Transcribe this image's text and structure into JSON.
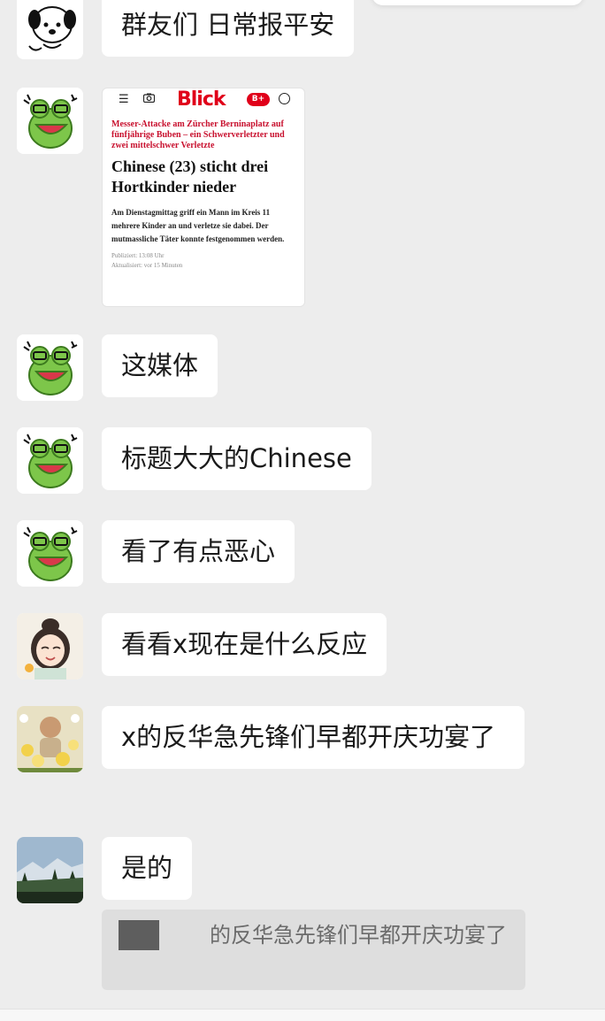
{
  "messages": [
    {
      "text": "群友们 日常报平安"
    },
    {
      "article": {
        "brand": "Blick",
        "plus_badge": "B+",
        "kicker": "Messer-Attacke am Zürcher Berninaplatz auf fünfjährige Buben – ein Schwerverletzter und zwei mittelschwer Verletzte",
        "headline": "Chinese (23) sticht drei Hortkinder nieder",
        "lead": "Am Dienstagmittag griff ein Mann im Kreis 11 mehrere Kinder an und verletze sie dabei. Der mutmassliche Täter konnte festgenommen werden.",
        "published": "Publiziert: 13:08 Uhr",
        "updated": "Aktualisiert: vor 15 Minuten"
      }
    },
    {
      "text": "这媒体"
    },
    {
      "text": "标题大大的Chinese"
    },
    {
      "text": "看了有点恶心"
    },
    {
      "text": "看看x现在是什么反应"
    },
    {
      "text": "x的反华急先锋们早都开庆功宴了"
    },
    {
      "text": "是的"
    }
  ],
  "quoted_reply": {
    "text": "的反华急先锋们早都开庆功宴了"
  },
  "icons": {
    "menu": "hamburger-icon",
    "camera": "camera-icon",
    "account": "user-icon"
  },
  "colors": {
    "background": "#ededed",
    "bubble": "#ffffff",
    "blick_red": "#e0001a",
    "kicker_red": "#c8102e",
    "frog_green": "#7dc64a"
  }
}
